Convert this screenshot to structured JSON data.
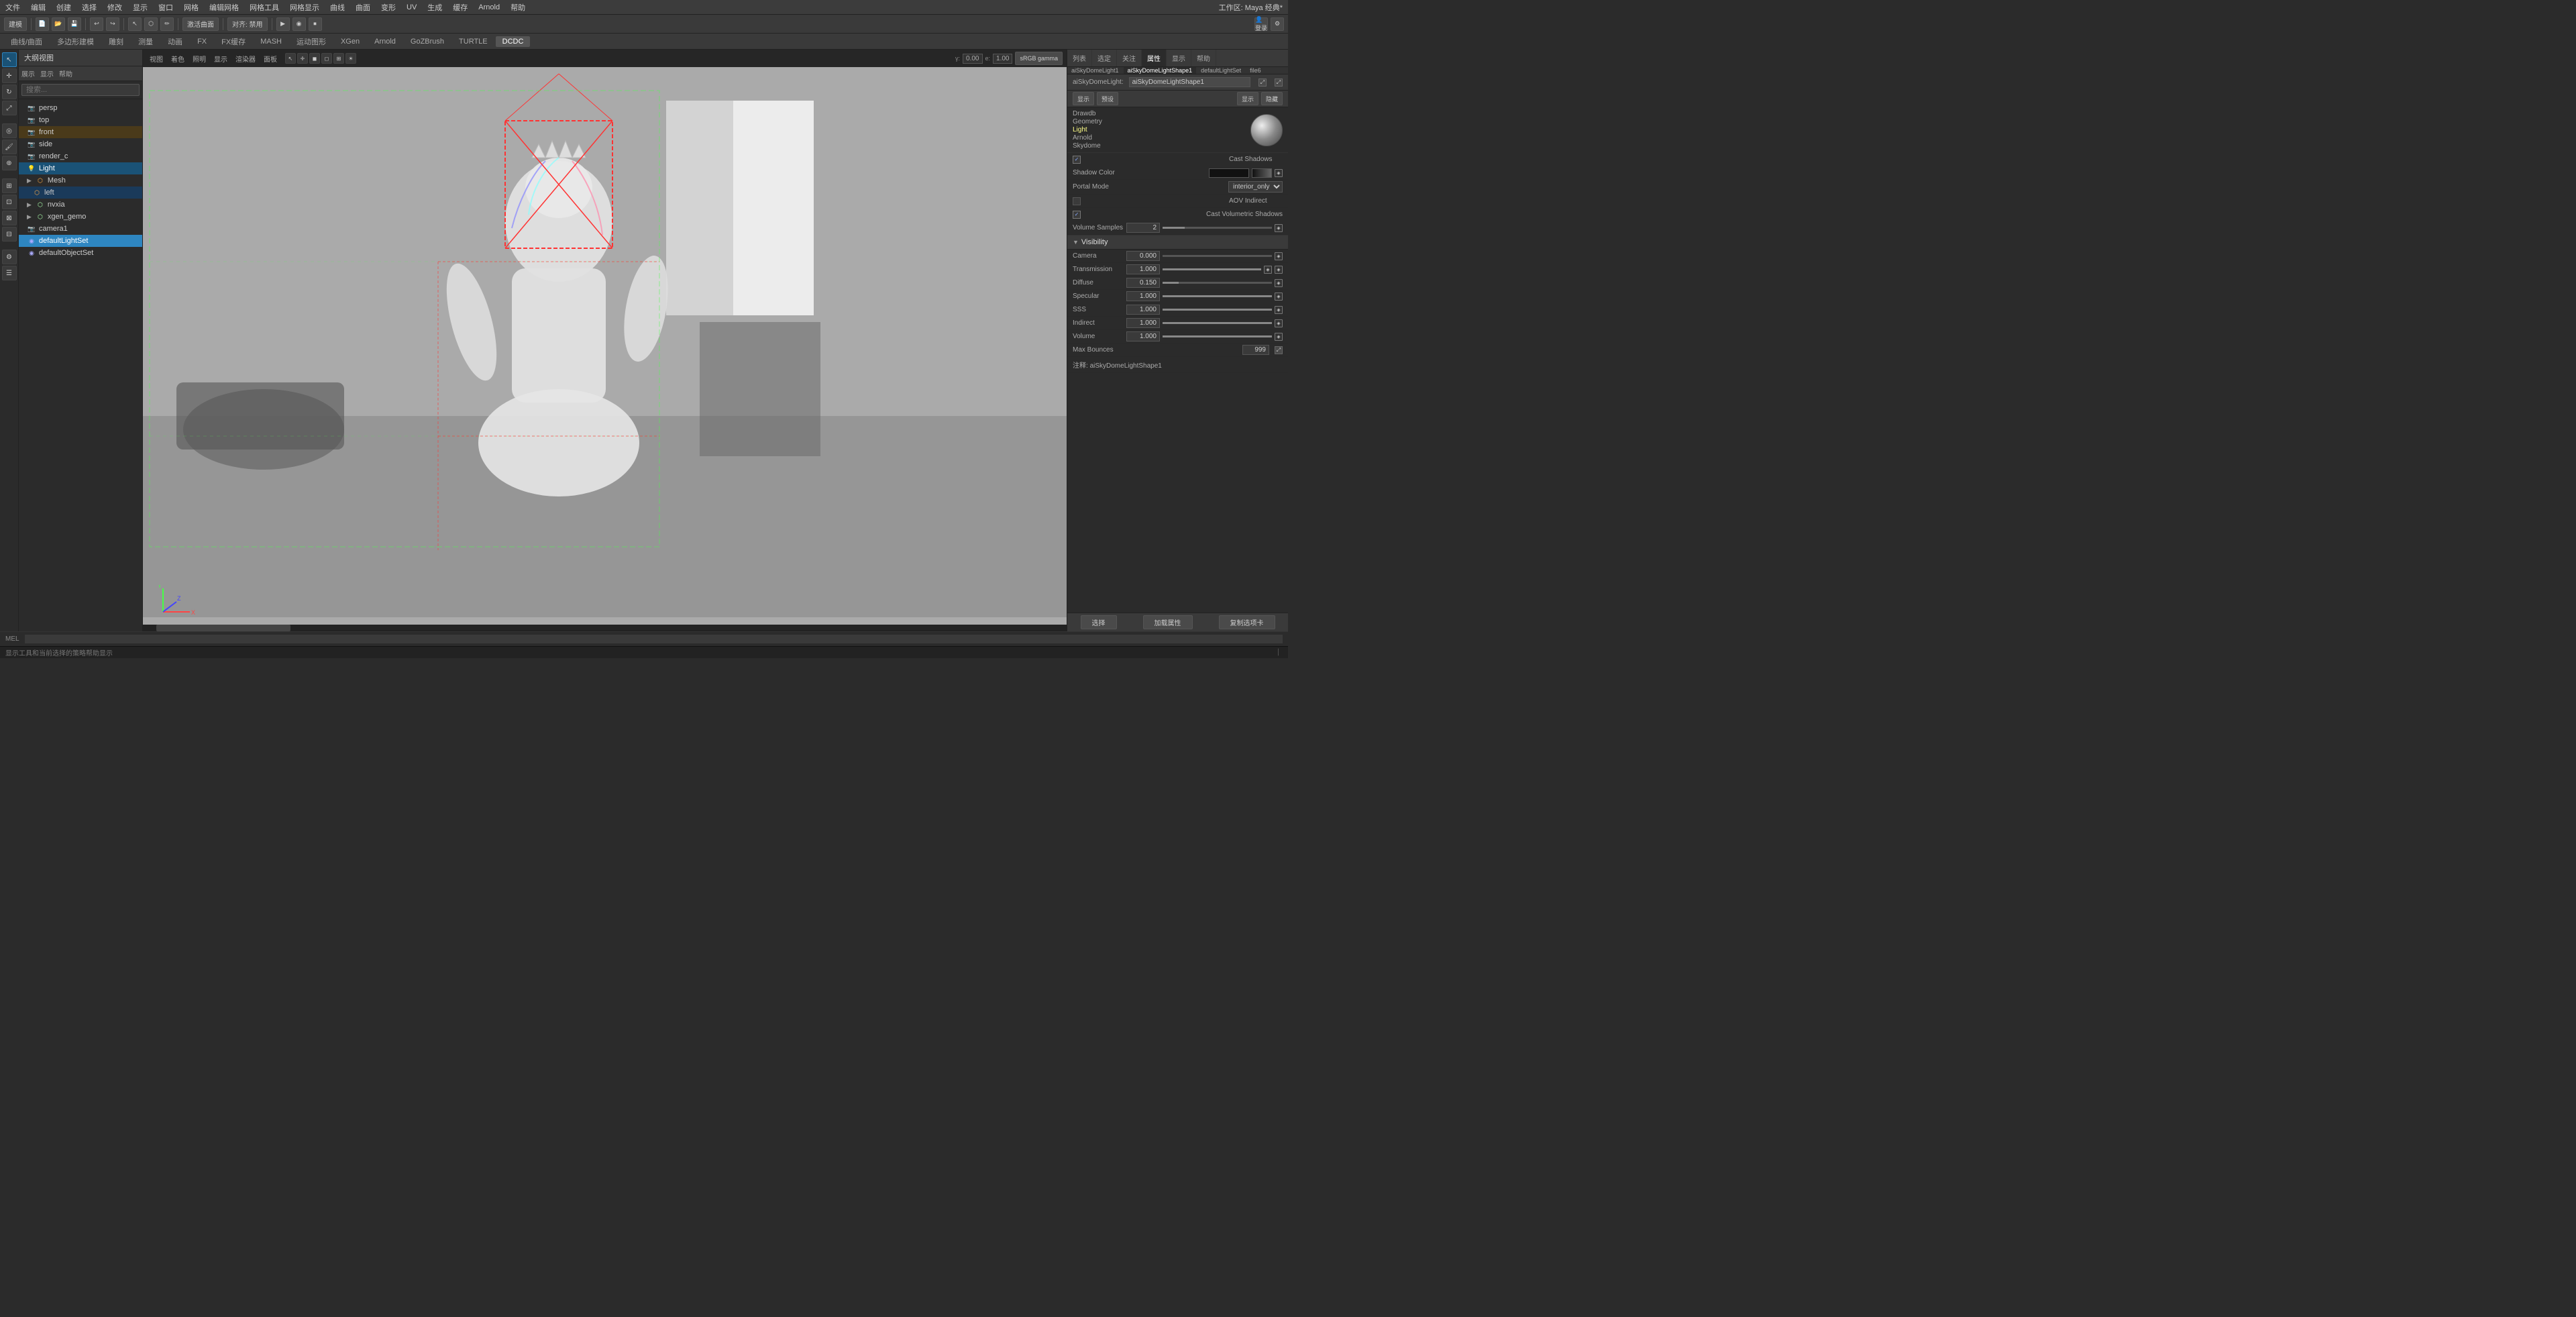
{
  "app": {
    "title": "Maya 经典*",
    "workspace": "建模"
  },
  "menubar": {
    "items": [
      "文件",
      "编辑",
      "创建",
      "选择",
      "修改",
      "显示",
      "窗口",
      "网格",
      "编辑网格",
      "网格工具",
      "网格显示",
      "曲线",
      "曲面",
      "变形",
      "UV",
      "生成",
      "缓存",
      "Arnold",
      "帮助"
    ]
  },
  "toolbar1": {
    "workspace_label": "建模",
    "buttons": [
      "新建",
      "打开",
      "保存",
      "撤销",
      "重做"
    ]
  },
  "tabs": {
    "items": [
      "曲线/曲面",
      "多边形建模",
      "雕刻",
      "测量",
      "动画",
      "FX",
      "FX缓存",
      "MASH",
      "运动图形",
      "XGen",
      "Arnold",
      "GoZBrush",
      "TURTLE",
      "DCDC"
    ],
    "active": "DCDC"
  },
  "sidebar": {
    "header": "大纲视图",
    "toolbar": [
      "展示",
      "显示",
      "帮助"
    ],
    "search_placeholder": "搜索...",
    "tree_items": [
      {
        "id": "persp",
        "label": "persp",
        "icon": "camera",
        "indent": 1
      },
      {
        "id": "top",
        "label": "top",
        "icon": "camera",
        "indent": 1
      },
      {
        "id": "front",
        "label": "front",
        "icon": "camera",
        "indent": 1,
        "selected": true,
        "highlight": "orange"
      },
      {
        "id": "side",
        "label": "side",
        "icon": "camera",
        "indent": 1
      },
      {
        "id": "render_c",
        "label": "render_c",
        "icon": "camera",
        "indent": 1
      },
      {
        "id": "Light",
        "label": "Light",
        "icon": "light",
        "indent": 1,
        "selected": true
      },
      {
        "id": "Mesh",
        "label": "Mesh",
        "icon": "mesh",
        "indent": 1,
        "group": true
      },
      {
        "id": "left",
        "label": "left",
        "icon": "mesh",
        "indent": 2
      },
      {
        "id": "nvxia",
        "label": "nvxia",
        "icon": "group",
        "indent": 1
      },
      {
        "id": "xgen_gemo",
        "label": "xgen_gemo",
        "icon": "group",
        "indent": 1
      },
      {
        "id": "camera1",
        "label": "camera1",
        "icon": "camera",
        "indent": 1
      },
      {
        "id": "defaultLightSet",
        "label": "defaultLightSet",
        "icon": "set",
        "indent": 1,
        "selected2": true
      },
      {
        "id": "defaultObjectSet",
        "label": "defaultObjectSet",
        "icon": "set",
        "indent": 1
      }
    ]
  },
  "viewport": {
    "toolbar_buttons": [
      "视图",
      "着色",
      "照明",
      "显示",
      "渲染器",
      "面板"
    ],
    "gamma_value": "0.00",
    "exposure_value": "1.00",
    "color_space": "sRGB gamma"
  },
  "right_panel": {
    "tabs": [
      "列表",
      "选定",
      "关注",
      "属性",
      "显示",
      "帮助"
    ],
    "active_tab": "属性",
    "node_tabs": [
      "aiSkyDomeLight1",
      "aiSkyDomeLightShape1",
      "defaultLightSet",
      "file6"
    ],
    "active_node_tab": "aiSkyDomeLightShape1",
    "node_label": "aiSkyDomeLight:",
    "node_name": "aiSkyDomeLightShape1",
    "buttons": [
      "显示",
      "预设",
      "显示",
      "隐藏"
    ],
    "sections": {
      "drawdb": {
        "label": "Drawdb",
        "geometry": "Geometry",
        "light": "Light",
        "arnold": "Arnold",
        "skydome": "Skydome"
      },
      "shadow": {
        "cast_shadows_label": "Cast Shadows",
        "cast_shadows_checked": true,
        "shadow_color_label": "Shadow Color",
        "portal_mode_label": "Portal Mode",
        "portal_mode_value": "interior_only",
        "aov_indirect_label": "AOV Indirect",
        "aov_indirect_checked": false,
        "cast_vol_shadows_label": "Cast Volumetric Shadows",
        "cast_vol_shadows_checked": true,
        "volume_samples_label": "Volume Samples",
        "volume_samples_value": "2"
      },
      "visibility": {
        "label": "Visibility",
        "camera_label": "Camera",
        "camera_value": "0.000",
        "camera_slider": 0,
        "transmission_label": "Transmission",
        "transmission_value": "1.000",
        "transmission_slider": 100,
        "diffuse_label": "Diffuse",
        "diffuse_value": "0.150",
        "diffuse_slider": 15,
        "specular_label": "Specular",
        "specular_value": "1.000",
        "specular_slider": 100,
        "sss_label": "SSS",
        "sss_value": "1.000",
        "sss_slider": 100,
        "indirect_label": "Indirect",
        "indirect_value": "1.000",
        "indirect_slider": 100,
        "volume_label": "Volume",
        "volume_value": "1.000",
        "volume_slider": 100,
        "max_bounces_label": "Max Bounces",
        "max_bounces_value": "999"
      }
    },
    "note_label": "注释:",
    "note_value": "aiSkyDomeLightShape1",
    "bottom_buttons": [
      "选择",
      "加载属性",
      "复制选项卡"
    ]
  },
  "mel_bar": {
    "label": "MEL"
  },
  "status_bar": {
    "text": "显示工具和当前选择的策略帮助显示"
  }
}
